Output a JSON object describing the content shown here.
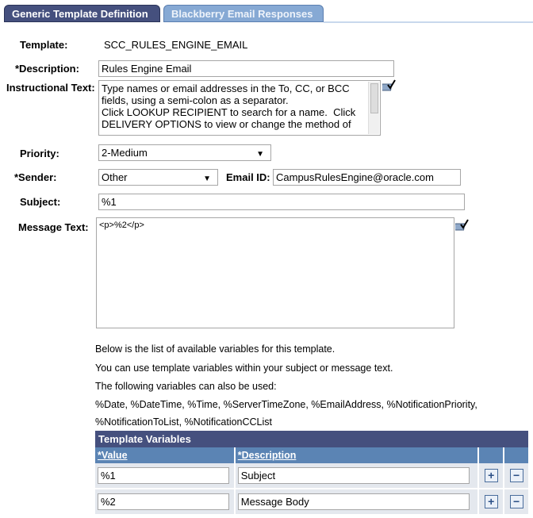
{
  "tabs": [
    {
      "label": "Generic Template Definition",
      "active": true
    },
    {
      "label": "Blackberry Email Responses",
      "active": false
    }
  ],
  "form": {
    "template_label": "Template:",
    "template_value": "SCC_RULES_ENGINE_EMAIL",
    "description_label": "*Description:",
    "description_value": "Rules Engine Email",
    "instructional_label": "Instructional Text:",
    "instructional_value": "Type names or email addresses in the To, CC, or BCC fields, using a semi-colon as a separator.\nClick LOOKUP RECIPIENT to search for a name.  Click DELIVERY OPTIONS to view or change the method of",
    "priority_label": "Priority:",
    "priority_value": "2-Medium",
    "sender_label": "*Sender:",
    "sender_value": "Other",
    "email_id_label": "Email ID:",
    "email_id_value": "CampusRulesEngine@oracle.com",
    "subject_label": "Subject:",
    "subject_value": "%1",
    "message_label": "Message Text:",
    "message_value": "<p>%2</p>"
  },
  "notes": [
    "Below is the list of available variables for this template.",
    "You can use template variables within your subject or message text.",
    "The following variables can also be used:",
    "%Date, %DateTime, %Time, %ServerTimeZone, %EmailAddress, %NotificationPriority,",
    "%NotificationToList, %NotificationCCList"
  ],
  "variables": {
    "title": "Template Variables",
    "columns": [
      "*Value",
      "*Description"
    ],
    "rows": [
      {
        "value": "%1",
        "description": "Subject"
      },
      {
        "value": "%2",
        "description": "Message Body"
      }
    ],
    "add_label": "+",
    "remove_label": "−"
  }
}
